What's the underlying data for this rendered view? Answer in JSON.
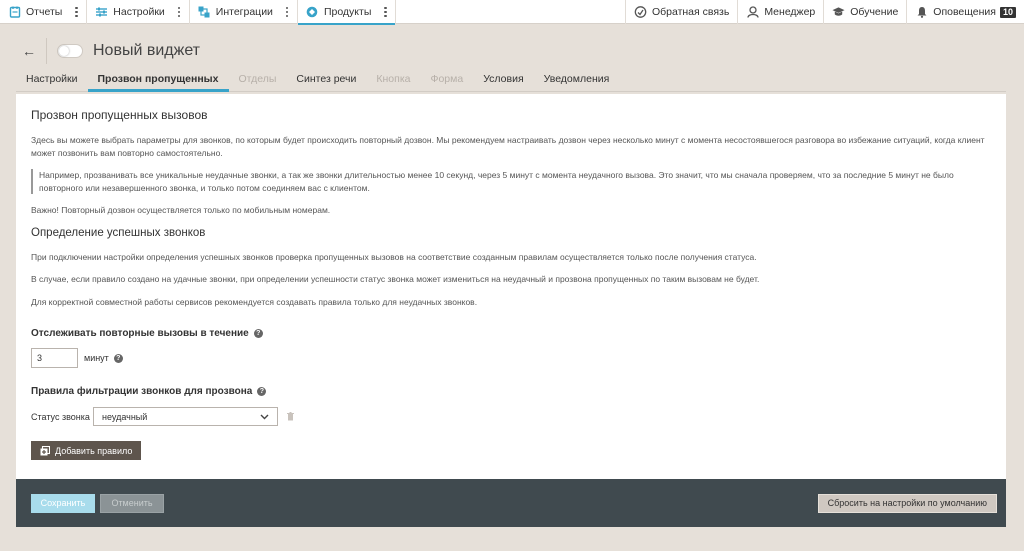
{
  "topnav": {
    "left": [
      {
        "label": "Отчеты",
        "icon": "reports-icon"
      },
      {
        "label": "Настройки",
        "icon": "settings-icon"
      },
      {
        "label": "Интеграции",
        "icon": "integrations-icon"
      },
      {
        "label": "Продукты",
        "icon": "products-icon"
      }
    ],
    "right": [
      {
        "label": "Обратная связь",
        "icon": "feedback-icon"
      },
      {
        "label": "Менеджер",
        "icon": "manager-icon"
      },
      {
        "label": "Обучение",
        "icon": "education-icon"
      },
      {
        "label": "Оповещения",
        "icon": "bell-icon",
        "badge": "10"
      }
    ]
  },
  "header": {
    "back": "←",
    "title": "Новый виджет"
  },
  "tabs": [
    {
      "label": "Настройки"
    },
    {
      "label": "Прозвон пропущенных"
    },
    {
      "label": "Отделы"
    },
    {
      "label": "Синтез речи"
    },
    {
      "label": "Кнопка"
    },
    {
      "label": "Форма"
    },
    {
      "label": "Условия"
    },
    {
      "label": "Уведомления"
    }
  ],
  "content": {
    "title": "Прозвон пропущенных вызовов",
    "intro": "Здесь вы можете выбрать параметры для звонков, по которым будет происходить повторный дозвон. Мы рекомендуем настраивать дозвон через несколько минут с момента несостоявшегося разговора во избежание ситуаций, когда клиент может позвонить вам повторно самостоятельно.",
    "example": "Например, прозванивать все уникальные неудачные звонки, а так же звонки длительностью менее 10 секунд, через 5 минут с момента неудачного вызова. Это значит, что мы сначала проверяем, что за последние 5 минут не было повторного или незавершенного звонка, и только потом соединяем вас с клиентом.",
    "important": "Важно! Повторный дозвон осуществляется только по мобильным номерам.",
    "success_title": "Определение успешных звонков",
    "success_p1": "При подключении настройки определения успешных звонков проверка пропущенных вызовов на соответствие созданным правилам осуществляется только после получения статуса.",
    "success_p2": "В случае, если правило создано на удачные звонки, при определении успешности статус звонка может измениться на неудачный и прозвона пропущенных по таким вызовам не будет.",
    "success_p3": "Для корректной совместной работы сервисов рекомендуется создавать правила только для неудачных звонков.",
    "track_label": "Отслеживать повторные вызовы в течение",
    "track_value": "3",
    "track_unit": "минут",
    "rules_label": "Правила фильтрации звонков для прозвона",
    "status_label": "Статус звонка",
    "status_value": "неудачный",
    "add_rule": "Добавить правило"
  },
  "footer": {
    "save": "Сохранить",
    "cancel": "Отменить",
    "reset": "Сбросить на настройки по умолчанию"
  },
  "colors": {
    "accent": "#38a3c9",
    "background": "#e6e0d9",
    "footer": "#404a4f",
    "add_button": "#5e554d"
  }
}
